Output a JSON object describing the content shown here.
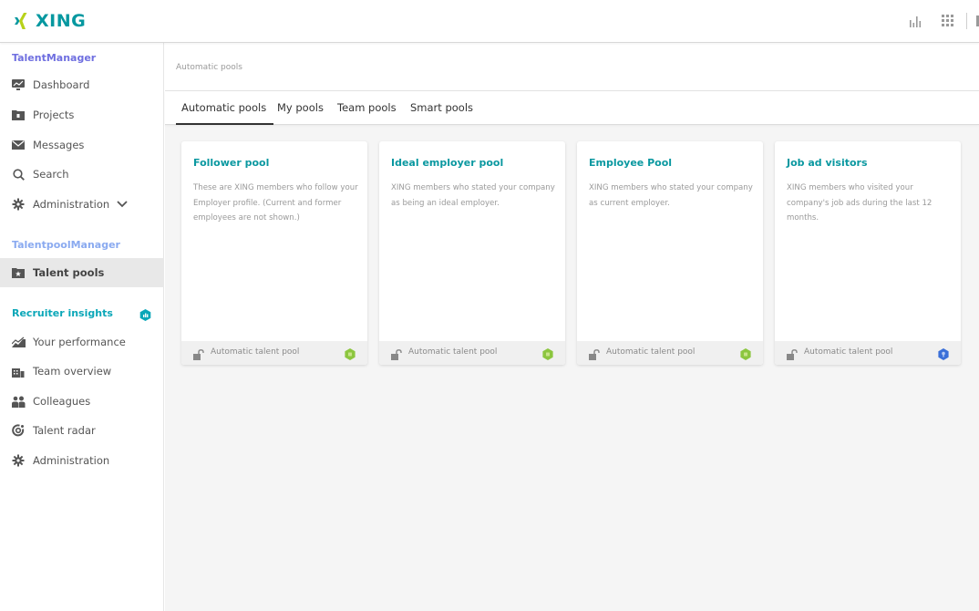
{
  "header": {
    "brand": "XING",
    "brand_color": "#0698a0",
    "brand_accent_color": "#b7d21a",
    "icons": [
      "stats-icon",
      "apps-grid-icon"
    ]
  },
  "sidebar": {
    "sections": [
      {
        "title": "TalentManager",
        "color": "#6f6fe0",
        "items": [
          {
            "label": "Dashboard",
            "icon": "dashboard-icon"
          },
          {
            "label": "Projects",
            "icon": "projects-folder-icon"
          },
          {
            "label": "Messages",
            "icon": "envelope-icon"
          },
          {
            "label": "Search",
            "icon": "search-icon"
          },
          {
            "label": "Administration",
            "icon": "gear-icon",
            "expandable": true
          }
        ]
      },
      {
        "title": "TalentpoolManager",
        "color": "#8aaaf0",
        "items": [
          {
            "label": "Talent pools",
            "icon": "star-folder-icon",
            "active": true
          }
        ]
      },
      {
        "title": "Recruiter insights",
        "color": "#0aa7b8",
        "badge_icon": "insights-hex-badge-icon",
        "items": [
          {
            "label": "Your performance",
            "icon": "performance-chart-icon"
          },
          {
            "label": "Team overview",
            "icon": "team-building-icon"
          },
          {
            "label": "Colleagues",
            "icon": "colleagues-icon"
          },
          {
            "label": "Talent radar",
            "icon": "radar-icon"
          },
          {
            "label": "Administration",
            "icon": "gear-icon"
          }
        ]
      }
    ]
  },
  "main": {
    "breadcrumb": "Automatic pools",
    "tabs": [
      {
        "label": "Automatic pools",
        "active": true
      },
      {
        "label": "My pools"
      },
      {
        "label": "Team pools"
      },
      {
        "label": "Smart pools"
      }
    ],
    "cards": [
      {
        "title": "Follower pool",
        "description": "These are XING members who follow your Employer profile. (Current and former employees are not shown.)",
        "footer": "Automatic talent pool",
        "badge_color": "#8cc63f",
        "badge_icon": "talentmanager-hex-icon"
      },
      {
        "title": "Ideal employer pool",
        "description": "XING members who stated your company as being an ideal employer.",
        "footer": "Automatic talent pool",
        "badge_color": "#8cc63f",
        "badge_icon": "talentmanager-hex-icon"
      },
      {
        "title": "Employee Pool",
        "description": "XING members who stated your company as current employer.",
        "footer": "Automatic talent pool",
        "badge_color": "#8cc63f",
        "badge_icon": "talentmanager-hex-icon"
      },
      {
        "title": "Job ad visitors",
        "description": "XING members who visited your company's job ads during the last 12 months.",
        "footer": "Automatic talent pool",
        "badge_color": "#3a6fd8",
        "badge_icon": "jobs-hex-icon"
      }
    ]
  }
}
